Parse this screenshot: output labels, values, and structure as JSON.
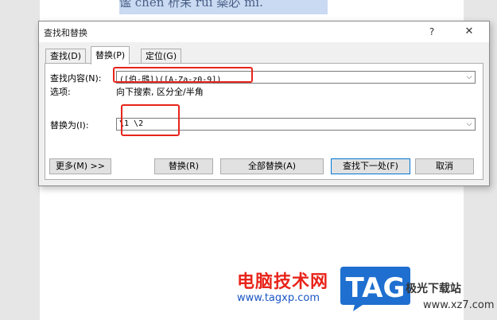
{
  "document": {
    "visible_text": "谧 chen 析呆 rui 橤必 mi."
  },
  "dialog": {
    "title": "查找和替换",
    "help": "?",
    "close": "✕",
    "tabs": [
      {
        "label": "查找(D)",
        "active": false
      },
      {
        "label": "替换(P)",
        "active": true
      },
      {
        "label": "定位(G)",
        "active": false
      }
    ],
    "find": {
      "label": "查找内容(N):",
      "value": "([伯-鴟])([A-Za-z0-9])"
    },
    "options": {
      "label": "选项:",
      "value": "向下搜索, 区分全/半角"
    },
    "replace": {
      "label": "替换为(I):",
      "value": "\\1 \\2"
    },
    "buttons": {
      "more": "更多(M) >>",
      "replace": "替换(R)",
      "replace_all": "全部替换(A)",
      "find_next": "查找下一处(F)",
      "cancel": "取消"
    },
    "colors": {
      "highlight": "#e8241b",
      "default_button_border": "#0078d7"
    }
  },
  "watermark": {
    "name": "电脑技术网",
    "url": "www.tagxp.com",
    "logo": "TAG",
    "site": "极光下载站",
    "site_url": "www.xz7.com"
  }
}
